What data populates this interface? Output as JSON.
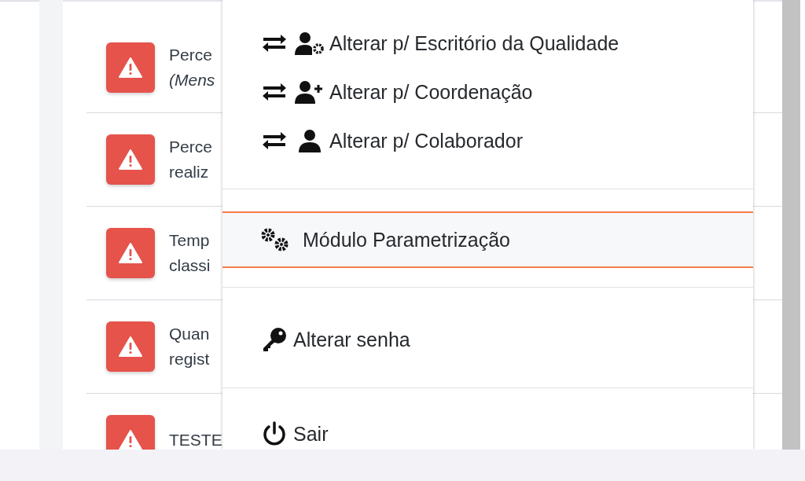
{
  "alerts": [
    {
      "lines": [
        {
          "text": "Perce",
          "italic": false
        },
        {
          "text": "(Mens",
          "italic": true
        }
      ]
    },
    {
      "lines": [
        {
          "text": "Perce",
          "italic": false
        },
        {
          "text": "realiz",
          "italic": false
        }
      ]
    },
    {
      "lines": [
        {
          "text": "Temp",
          "italic": false
        },
        {
          "text": "classi",
          "italic": false
        }
      ]
    },
    {
      "lines": [
        {
          "text": "Quan",
          "italic": false
        },
        {
          "text": "regist",
          "italic": false
        }
      ]
    },
    {
      "lines": [
        {
          "text": "TESTE",
          "italic": false
        }
      ]
    }
  ],
  "menu": {
    "groups": [
      {
        "items": [
          {
            "kind": "switch-office",
            "label": "Alterar p/ Escritório da Qualidade",
            "selected": false
          },
          {
            "kind": "switch-coord",
            "label": "Alterar p/ Coordenação",
            "selected": false
          },
          {
            "kind": "switch-user",
            "label": "Alterar p/ Colaborador",
            "selected": false
          }
        ]
      },
      {
        "items": [
          {
            "kind": "params",
            "label": "Módulo Parametrização",
            "selected": true
          }
        ]
      },
      {
        "items": [
          {
            "kind": "password",
            "label": "Alterar senha",
            "selected": false
          }
        ]
      },
      {
        "items": [
          {
            "kind": "logout",
            "label": "Sair",
            "selected": false
          }
        ]
      }
    ]
  }
}
